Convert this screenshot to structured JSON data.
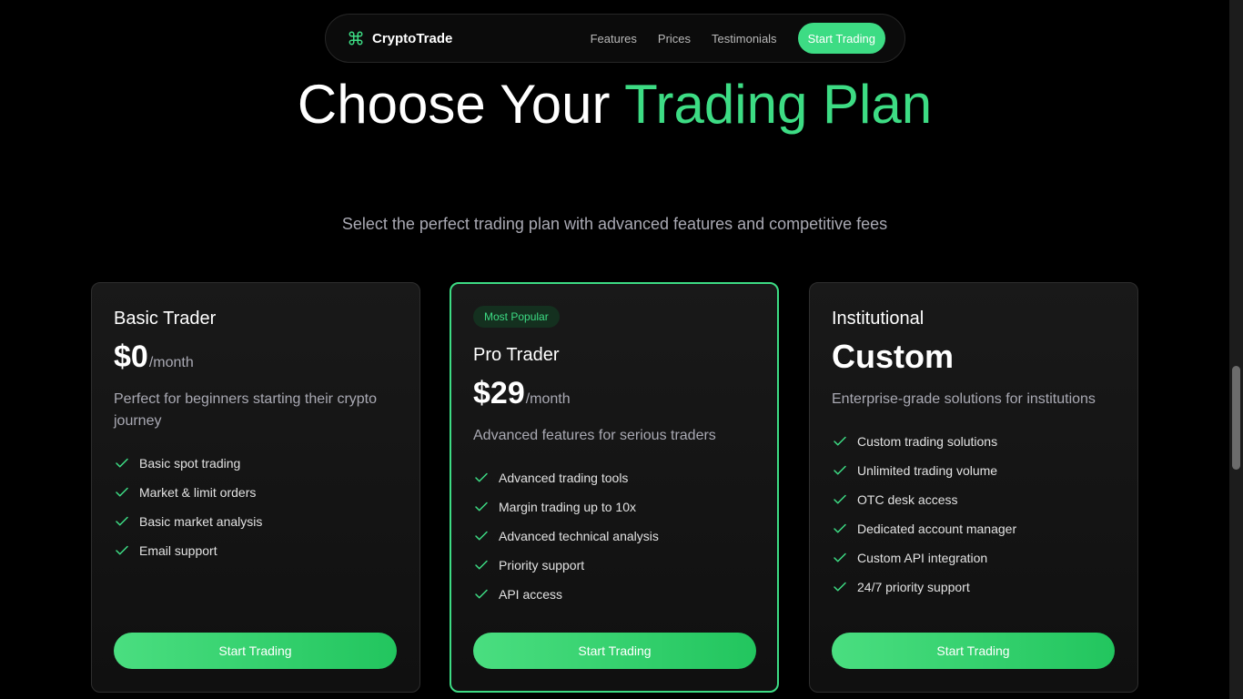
{
  "nav": {
    "brand": "CryptoTrade",
    "brand_icon": "command-icon",
    "links": [
      "Features",
      "Prices",
      "Testimonials"
    ],
    "cta": "Start Trading"
  },
  "hero": {
    "title_white": "Choose Your ",
    "title_accent": "Trading Plan",
    "subtitle": "Select the perfect trading plan with advanced features and competitive fees"
  },
  "colors": {
    "accent": "#3ddc84",
    "background": "#000000",
    "card_background": "#141414",
    "muted_text": "#a9a9b3"
  },
  "plans": [
    {
      "name": "Basic Trader",
      "price": "$0",
      "period": "/month",
      "description": "Perfect for beginners starting their crypto journey",
      "features": [
        "Basic spot trading",
        "Market & limit orders",
        "Basic market analysis",
        "Email support"
      ],
      "cta": "Start Trading"
    },
    {
      "badge": "Most Popular",
      "name": "Pro Trader",
      "price": "$29",
      "period": "/month",
      "description": "Advanced features for serious traders",
      "features": [
        "Advanced trading tools",
        "Margin trading up to 10x",
        "Advanced technical analysis",
        "Priority support",
        "API access"
      ],
      "cta": "Start Trading"
    },
    {
      "name": "Institutional",
      "price": "Custom",
      "description": "Enterprise-grade solutions for institutions",
      "features": [
        "Custom trading solutions",
        "Unlimited trading volume",
        "OTC desk access",
        "Dedicated account manager",
        "Custom API integration",
        "24/7 priority support"
      ],
      "cta": "Start Trading"
    }
  ]
}
